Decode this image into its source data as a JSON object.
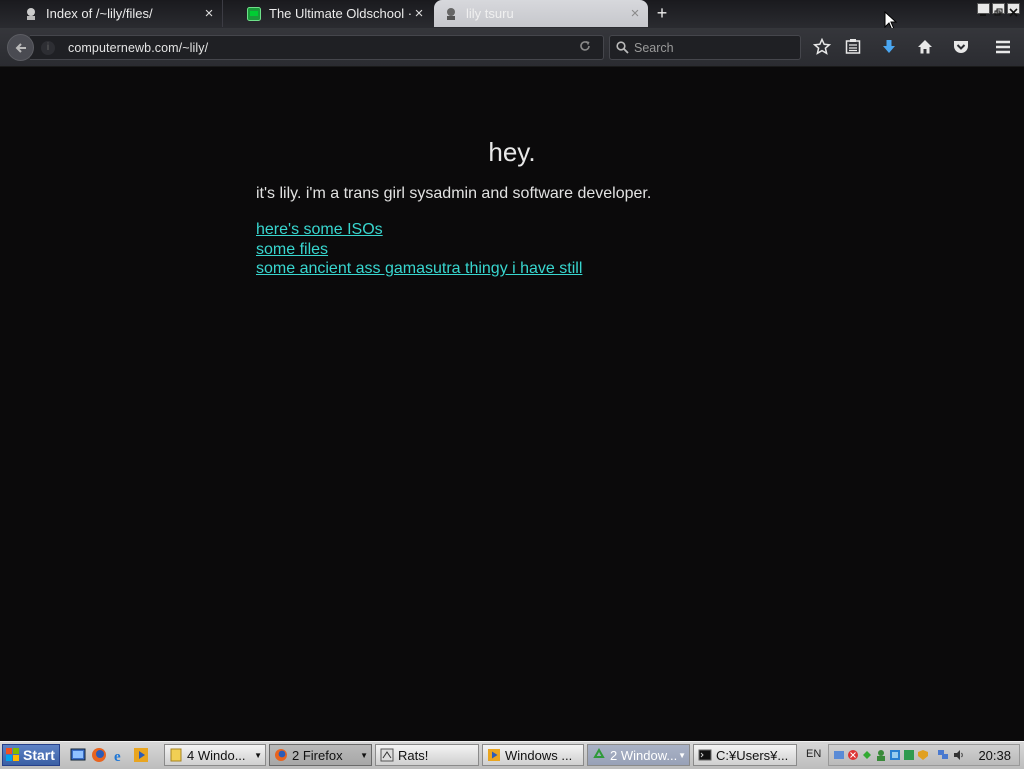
{
  "browser": {
    "tabs": [
      {
        "title": "Index of /~lily/files/",
        "close": "×"
      },
      {
        "title": "The Ultimate Oldschool ···",
        "close": "×"
      },
      {
        "title": "lily tsuru",
        "close": "×"
      }
    ],
    "new_tab": "+",
    "url": "computernewb.com/~lily/",
    "search_placeholder": "Search"
  },
  "page": {
    "heading": "hey.",
    "intro": "it's lily. i'm a trans girl sysadmin and software developer.",
    "links": [
      "here's some ISOs",
      "some files",
      "some ancient ass gamasutra thingy i have still"
    ]
  },
  "taskbar": {
    "start": "Start",
    "buttons": [
      {
        "label": "4  Windo...",
        "has_arrow": true
      },
      {
        "label": "2  Firefox",
        "has_arrow": true
      },
      {
        "label": "Rats!",
        "has_arrow": false
      },
      {
        "label": "Windows ...",
        "has_arrow": false
      },
      {
        "label": "2  Window...",
        "has_arrow": true
      },
      {
        "label": "C:¥Users¥...",
        "has_arrow": false
      }
    ],
    "language": "EN",
    "clock": "20:38"
  },
  "colors": {
    "page_background": "#0b0a0b",
    "link": "#38d6cf",
    "text": "#e2e2e2"
  }
}
